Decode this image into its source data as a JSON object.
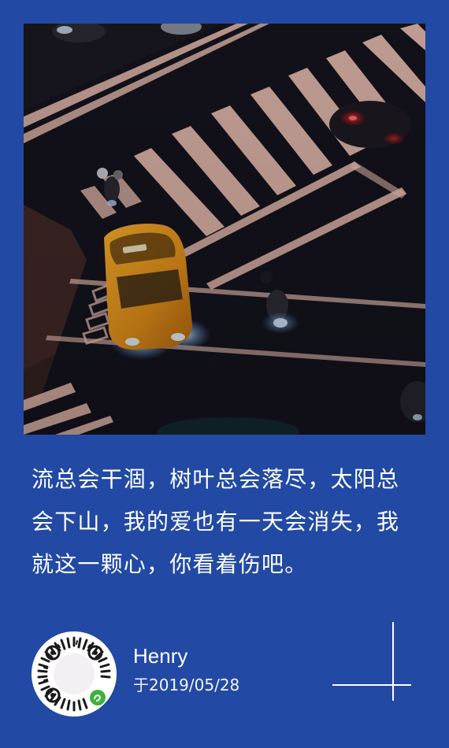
{
  "colors": {
    "background": "#2249a3",
    "text": "#ffffff",
    "taxi": "#f0a51e",
    "road": "#14131d",
    "road_marking": "#f4c6b8"
  },
  "photo": {
    "subject": "night-street-crosswalk-taxi"
  },
  "quote": {
    "text": "流总会干涸，树叶总会落尽，太阳总会下山，我的爱也有一天会消失，我就这一颗心，你看着伤吧。"
  },
  "author": {
    "name": "Henry",
    "date": "于2019/05/28"
  },
  "qr_code": {
    "icon": "mini-program-qr-code"
  }
}
